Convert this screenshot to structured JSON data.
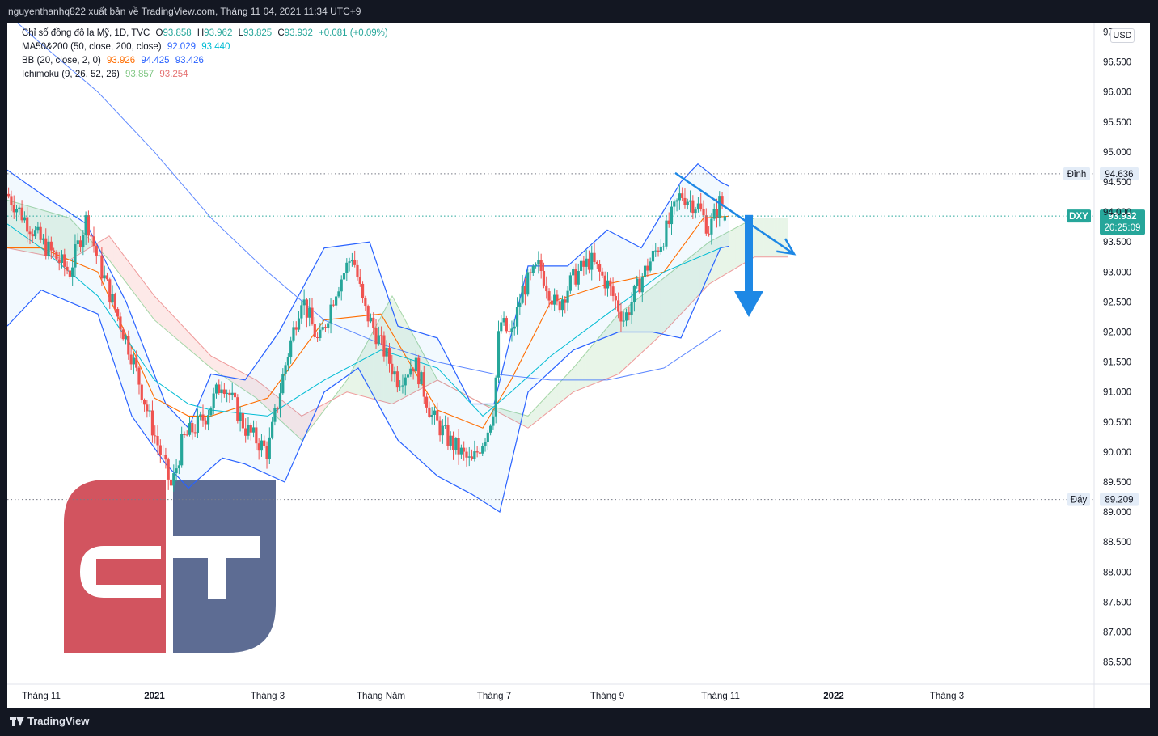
{
  "header": {
    "publisher_text": "nguyenthanhq822 xuất bản về TradingView.com, Tháng 11 04, 2021 11:34 UTC+9"
  },
  "legend": {
    "symbol": {
      "name": "Chỉ số đồng đô la Mỹ, 1D, TVC",
      "o_label": "O",
      "o_value": "93.858",
      "h_label": "H",
      "h_value": "93.962",
      "l_label": "L",
      "l_value": "93.825",
      "c_label": "C",
      "c_value": "93.932",
      "change": "+0.081 (+0.09%)"
    },
    "ma": {
      "label": "MA50&200 (50, close, 200, close)",
      "v1": "92.029",
      "v2": "93.440"
    },
    "bb": {
      "label": "BB (20, close, 2, 0)",
      "v1": "93.926",
      "v2": "94.425",
      "v3": "93.426"
    },
    "ichimoku": {
      "label": "Ichimoku (9, 26, 52, 26)",
      "v1": "93.857",
      "v2": "93.254"
    }
  },
  "currency_label": "USD",
  "price_tags": {
    "dinh_label": "Đỉnh",
    "dinh_value": "94.636",
    "day_label": "Đáy",
    "day_value": "89.209",
    "symbol_tag": "DXY",
    "last_price": "93.932",
    "countdown": "20:25:09"
  },
  "footer": {
    "brand": "TradingView"
  },
  "colors": {
    "up": "#26a69a",
    "down": "#ef5350",
    "bb": "#2962ff",
    "ma50": "#00bcd4",
    "ma200": "#2962ff",
    "bb_basis": "#ff6d00",
    "arrow": "#1e88e5",
    "logo_red": "#d2545f",
    "logo_blue": "#5d6c93"
  },
  "chart_data": {
    "type": "candlestick",
    "title": "Chỉ số đồng đô la Mỹ, 1D, TVC",
    "y_axis": {
      "ticks": [
        "86.500",
        "87.000",
        "87.500",
        "88.000",
        "88.500",
        "89.000",
        "89.500",
        "90.000",
        "90.500",
        "91.000",
        "91.500",
        "92.000",
        "92.500",
        "93.000",
        "93.500",
        "94.000",
        "94.500",
        "95.000",
        "95.500",
        "96.000",
        "96.500",
        "97.000"
      ],
      "range": [
        86.2,
        97.0
      ]
    },
    "x_axis": {
      "ticks": [
        {
          "label": "Tháng 11",
          "t": 0
        },
        {
          "label": "2021",
          "t": 2
        },
        {
          "label": "Tháng 3",
          "t": 4
        },
        {
          "label": "Tháng Năm",
          "t": 6
        },
        {
          "label": "Tháng 7",
          "t": 8
        },
        {
          "label": "Tháng 9",
          "t": 10
        },
        {
          "label": "Tháng 11",
          "t": 12
        },
        {
          "label": "2022",
          "t": 14
        },
        {
          "label": "Tháng 3",
          "t": 16
        }
      ],
      "range_months": [
        -0.6,
        18.6
      ]
    },
    "price_path": [
      [
        -0.6,
        94.3
      ],
      [
        0.0,
        93.5
      ],
      [
        0.5,
        93.0
      ],
      [
        0.8,
        93.9
      ],
      [
        1.0,
        93.2
      ],
      [
        1.3,
        92.4
      ],
      [
        1.6,
        91.6
      ],
      [
        1.9,
        90.6
      ],
      [
        2.1,
        90.0
      ],
      [
        2.3,
        89.4
      ],
      [
        2.5,
        90.2
      ],
      [
        2.9,
        90.6
      ],
      [
        3.2,
        91.2
      ],
      [
        3.6,
        90.4
      ],
      [
        4.0,
        90.0
      ],
      [
        4.3,
        91.4
      ],
      [
        4.6,
        92.6
      ],
      [
        4.9,
        91.8
      ],
      [
        5.2,
        92.7
      ],
      [
        5.5,
        93.3
      ],
      [
        5.7,
        92.4
      ],
      [
        6.0,
        91.8
      ],
      [
        6.3,
        91.2
      ],
      [
        6.6,
        91.5
      ],
      [
        6.9,
        90.6
      ],
      [
        7.2,
        90.2
      ],
      [
        7.6,
        89.8
      ],
      [
        7.9,
        90.4
      ],
      [
        8.0,
        90.8
      ],
      [
        8.1,
        92.2
      ],
      [
        8.3,
        91.9
      ],
      [
        8.5,
        92.7
      ],
      [
        8.8,
        93.1
      ],
      [
        9.1,
        92.4
      ],
      [
        9.4,
        92.9
      ],
      [
        9.7,
        93.2
      ],
      [
        10.0,
        92.8
      ],
      [
        10.3,
        92.2
      ],
      [
        10.6,
        92.9
      ],
      [
        11.0,
        93.6
      ],
      [
        11.3,
        94.3
      ],
      [
        11.6,
        94.1
      ],
      [
        11.8,
        93.7
      ],
      [
        12.0,
        94.2
      ],
      [
        12.1,
        93.9
      ]
    ],
    "last": {
      "open": 93.858,
      "high": 93.962,
      "low": 93.825,
      "close": 93.932,
      "change": "+0.081 (+0.09%)"
    },
    "levels": {
      "dinh": 94.636,
      "day": 89.209,
      "last": 93.932
    },
    "indicators": {
      "ma50": [
        [
          -0.6,
          93.8
        ],
        [
          0,
          93.4
        ],
        [
          1,
          92.6
        ],
        [
          2,
          91.2
        ],
        [
          2.6,
          90.8
        ],
        [
          3,
          90.7
        ],
        [
          4,
          90.6
        ],
        [
          5,
          91.2
        ],
        [
          6,
          91.7
        ],
        [
          7,
          91.4
        ],
        [
          7.8,
          90.6
        ],
        [
          8.3,
          91.0
        ],
        [
          9,
          91.6
        ],
        [
          10,
          92.3
        ],
        [
          11,
          93.0
        ],
        [
          12,
          93.4
        ]
      ],
      "ma200": [
        [
          -0.6,
          97.3
        ],
        [
          0,
          96.8
        ],
        [
          1,
          96.0
        ],
        [
          2,
          95.0
        ],
        [
          3,
          93.9
        ],
        [
          4,
          93.0
        ],
        [
          5,
          92.2
        ],
        [
          6,
          91.8
        ],
        [
          7,
          91.5
        ],
        [
          8,
          91.3
        ],
        [
          9,
          91.2
        ],
        [
          10,
          91.2
        ],
        [
          11,
          91.4
        ],
        [
          12,
          92.03
        ]
      ],
      "bb_upper": [
        [
          -0.6,
          94.7
        ],
        [
          0,
          94.3
        ],
        [
          0.8,
          93.8
        ],
        [
          1.5,
          92.5
        ],
        [
          2.2,
          90.8
        ],
        [
          2.6,
          90.4
        ],
        [
          3.0,
          91.3
        ],
        [
          3.6,
          91.2
        ],
        [
          4.2,
          92.0
        ],
        [
          5.0,
          93.4
        ],
        [
          5.8,
          93.5
        ],
        [
          6.3,
          92.1
        ],
        [
          7.0,
          91.9
        ],
        [
          7.6,
          90.8
        ],
        [
          8.0,
          90.8
        ],
        [
          8.6,
          93.1
        ],
        [
          9.3,
          93.1
        ],
        [
          10.0,
          93.7
        ],
        [
          10.6,
          93.4
        ],
        [
          11.3,
          94.5
        ],
        [
          11.6,
          94.8
        ],
        [
          12.0,
          94.5
        ],
        [
          12.15,
          94.43
        ]
      ],
      "bb_lower": [
        [
          -0.6,
          92.1
        ],
        [
          0,
          92.7
        ],
        [
          1,
          92.3
        ],
        [
          1.6,
          90.6
        ],
        [
          2.2,
          89.8
        ],
        [
          2.6,
          89.4
        ],
        [
          3.2,
          89.9
        ],
        [
          3.6,
          89.8
        ],
        [
          4.3,
          89.5
        ],
        [
          5.0,
          91.0
        ],
        [
          5.6,
          91.4
        ],
        [
          6.3,
          90.2
        ],
        [
          7.0,
          89.6
        ],
        [
          7.6,
          89.3
        ],
        [
          8.1,
          89.0
        ],
        [
          8.6,
          91.0
        ],
        [
          9.4,
          91.7
        ],
        [
          10.2,
          92.0
        ],
        [
          10.8,
          92.0
        ],
        [
          11.3,
          91.9
        ],
        [
          12.0,
          93.4
        ],
        [
          12.15,
          93.43
        ]
      ],
      "bb_basis": [
        [
          -0.6,
          93.4
        ],
        [
          0,
          93.4
        ],
        [
          1,
          93.0
        ],
        [
          2,
          90.9
        ],
        [
          2.6,
          90.6
        ],
        [
          3,
          90.6
        ],
        [
          4,
          90.9
        ],
        [
          5,
          92.2
        ],
        [
          6,
          92.3
        ],
        [
          7,
          90.7
        ],
        [
          7.8,
          90.4
        ],
        [
          8.3,
          91.2
        ],
        [
          9,
          92.5
        ],
        [
          10,
          92.8
        ],
        [
          11,
          93.0
        ],
        [
          11.7,
          93.9
        ],
        [
          12.15,
          93.93
        ]
      ],
      "cloud_span_a": [
        [
          -0.6,
          94.2
        ],
        [
          0.5,
          93.9
        ],
        [
          1.2,
          93.2
        ],
        [
          2.0,
          92.2
        ],
        [
          3.0,
          91.4
        ],
        [
          3.8,
          90.9
        ],
        [
          4.6,
          90.2
        ],
        [
          5.4,
          91.2
        ],
        [
          6.2,
          92.6
        ],
        [
          7.0,
          91.2
        ],
        [
          7.8,
          90.8
        ],
        [
          8.6,
          90.6
        ],
        [
          9.4,
          91.4
        ],
        [
          10.2,
          92.3
        ],
        [
          11.0,
          92.9
        ],
        [
          11.8,
          93.5
        ],
        [
          12.6,
          93.9
        ],
        [
          13.2,
          93.9
        ]
      ],
      "cloud_span_b": [
        [
          -0.6,
          93.4
        ],
        [
          0.5,
          93.2
        ],
        [
          1.2,
          93.6
        ],
        [
          2.0,
          92.6
        ],
        [
          3.0,
          91.6
        ],
        [
          3.8,
          91.2
        ],
        [
          4.6,
          90.6
        ],
        [
          5.4,
          91.0
        ],
        [
          6.2,
          90.8
        ],
        [
          7.0,
          91.2
        ],
        [
          7.8,
          90.8
        ],
        [
          8.6,
          90.4
        ],
        [
          9.4,
          91.0
        ],
        [
          10.2,
          91.3
        ],
        [
          11.0,
          92.0
        ],
        [
          11.8,
          92.8
        ],
        [
          12.6,
          93.25
        ],
        [
          13.2,
          93.25
        ]
      ]
    },
    "annotations": {
      "trend_line": [
        [
          11.2,
          94.65
        ],
        [
          13.3,
          93.3
        ]
      ],
      "down_arrow": {
        "t": 12.5,
        "from": 93.95,
        "to": 92.25
      },
      "watermark": "CT"
    }
  }
}
